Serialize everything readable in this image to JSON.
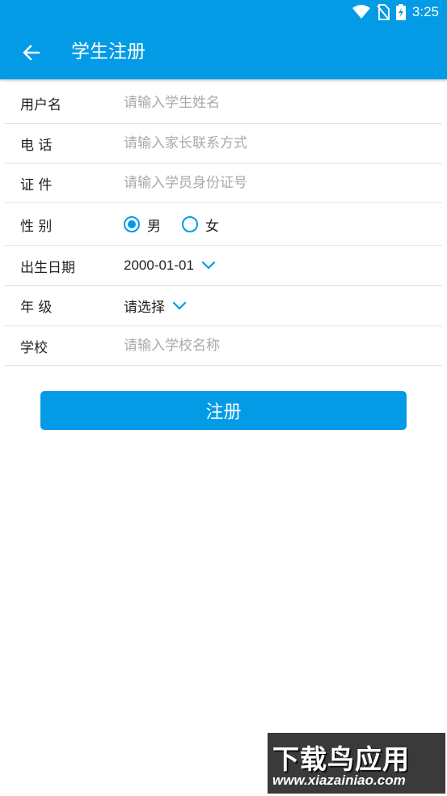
{
  "status_bar": {
    "time": "3:25"
  },
  "app_bar": {
    "title": "学生注册"
  },
  "form": {
    "username": {
      "label": "用户名",
      "placeholder": "请输入学生姓名"
    },
    "phone": {
      "label": "电 话",
      "placeholder": "请输入家长联系方式"
    },
    "id_card": {
      "label": "证 件",
      "placeholder": "请输入学员身份证号"
    },
    "gender": {
      "label": "性 别",
      "options": [
        "男",
        "女"
      ],
      "selected": "男"
    },
    "birthday": {
      "label": "出生日期",
      "value": "2000-01-01"
    },
    "grade": {
      "label": "年 级",
      "value": "请选择"
    },
    "school": {
      "label": "学校",
      "placeholder": "请输入学校名称"
    }
  },
  "submit_label": "注册",
  "watermark": {
    "title": "下载鸟应用",
    "url": "www.xiazainiao.com"
  },
  "colors": {
    "primary": "#039be5"
  }
}
